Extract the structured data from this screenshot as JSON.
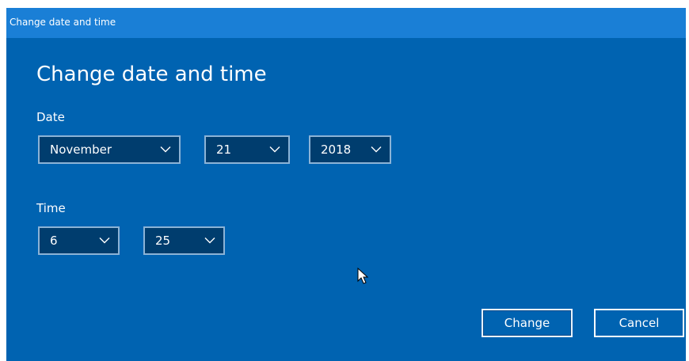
{
  "window": {
    "title": "Change date and time"
  },
  "main": {
    "heading": "Change date and time",
    "date_label": "Date",
    "time_label": "Time",
    "date": {
      "month": "November",
      "day": "21",
      "year": "2018"
    },
    "time": {
      "hour": "6",
      "minute": "25"
    },
    "buttons": {
      "change": "Change",
      "cancel": "Cancel"
    }
  },
  "colors": {
    "background": "#0063b1",
    "titlebar": "#1a7fd6",
    "dropdown": "#003d6e",
    "text": "#ffffff"
  },
  "icons": {
    "dropdown_arrow": "chevron-down-icon",
    "pointer": "mouse-cursor-icon"
  }
}
